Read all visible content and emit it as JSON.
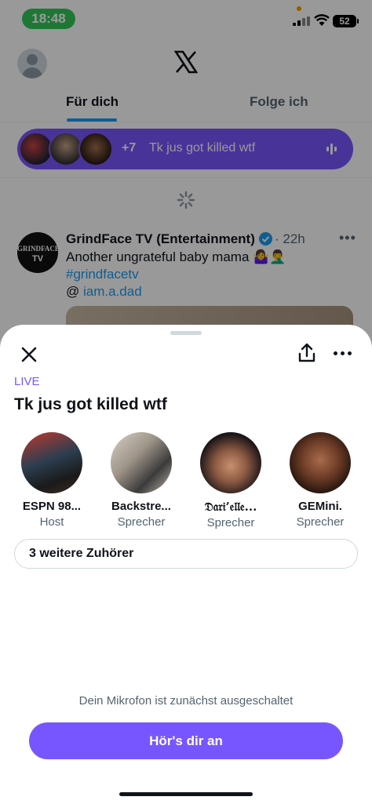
{
  "status_bar": {
    "time": "18:48",
    "battery": "52"
  },
  "header": {
    "tabs": [
      {
        "label": "Für dich"
      },
      {
        "label": "Folge ich"
      }
    ]
  },
  "space_bar": {
    "extra_count": "+7",
    "title": "Tk jus got killed wtf"
  },
  "tweet": {
    "author": "GrindFace TV (Entertainment)",
    "time": "· 22h",
    "text": "Another ungrateful baby mama 🤷‍♀️🤦‍♂️",
    "hashtag": "#grindfacetv",
    "mention_prefix": "@",
    "mention": "iam.a.dad",
    "avatar_text": "GRINDFACE",
    "avatar_sub": "TV"
  },
  "sheet": {
    "live_label": "LIVE",
    "title": "Tk jus got killed wtf",
    "speakers": [
      {
        "name": "ESPN 98...",
        "role": "Host"
      },
      {
        "name": "Backstre...",
        "role": "Sprecher"
      },
      {
        "name": "𝔇𝔞𝔯𝔦’𝔢𝔩𝔩𝔢...",
        "role": "Sprecher"
      },
      {
        "name": "GEMini.",
        "role": "Sprecher"
      }
    ],
    "listeners_button": "3 weitere Zuhörer",
    "mic_note": "Dein Mikrofon ist zunächst ausgeschaltet",
    "listen_button": "Hör's dir an"
  },
  "colors": {
    "accent": "#7856ff",
    "link": "#1d9bf0",
    "status_green": "#34c759"
  }
}
